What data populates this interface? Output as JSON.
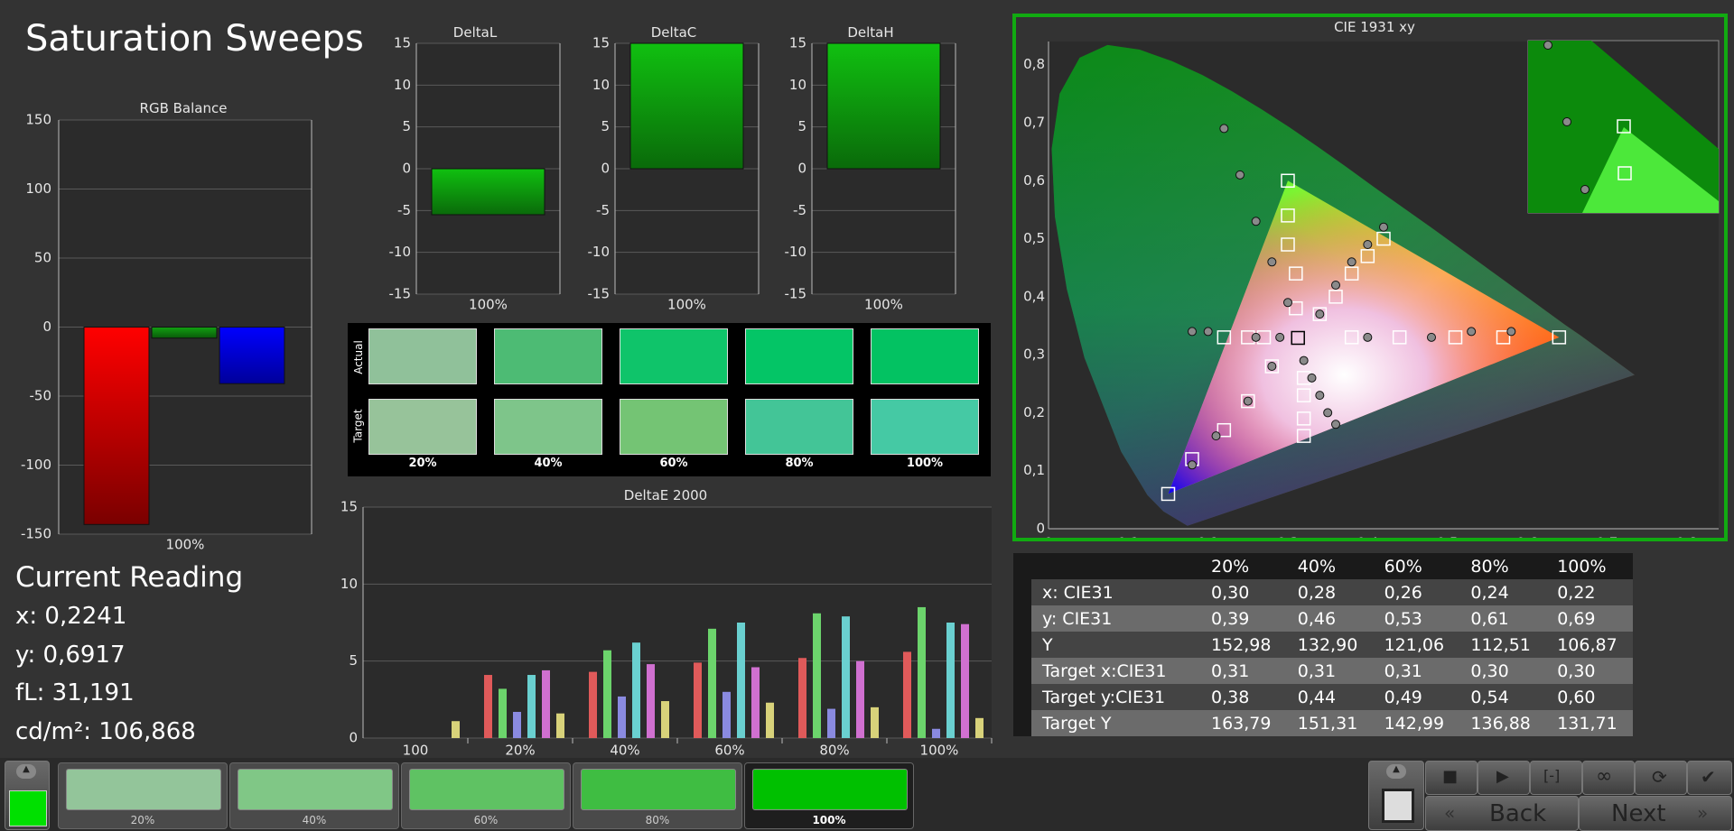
{
  "page": {
    "title": "Saturation Sweeps"
  },
  "colors": {
    "accent_green": "#00c800",
    "frame_green": "#11aa11",
    "selected_swatch": "#00c800"
  },
  "rgb_balance": {
    "title": "RGB Balance",
    "y_ticks": [
      "150",
      "100",
      "50",
      "0",
      "-50",
      "-100",
      "-150"
    ],
    "x_label": "100%",
    "chart_data": {
      "type": "bar",
      "categories": [
        "R",
        "G",
        "B"
      ],
      "values": [
        -143,
        -8,
        -41
      ],
      "ylim": [
        -150,
        150
      ]
    }
  },
  "delta_l": {
    "title": "DeltaL",
    "y_ticks": [
      "15",
      "10",
      "5",
      "0",
      "-5",
      "-10",
      "-15"
    ],
    "x_label": "100%",
    "chart_data": {
      "type": "bar",
      "values": [
        -5.5
      ],
      "ylim": [
        -15,
        15
      ]
    }
  },
  "delta_c": {
    "title": "DeltaC",
    "y_ticks": [
      "15",
      "10",
      "5",
      "0",
      "-5",
      "-10",
      "-15"
    ],
    "x_label": "100%",
    "chart_data": {
      "type": "bar",
      "values": [
        15
      ],
      "ylim": [
        -15,
        15
      ]
    }
  },
  "delta_h": {
    "title": "DeltaH",
    "y_ticks": [
      "15",
      "10",
      "5",
      "0",
      "-5",
      "-10",
      "-15"
    ],
    "x_label": "100%",
    "chart_data": {
      "type": "bar",
      "values": [
        15
      ],
      "ylim": [
        -15,
        15
      ]
    }
  },
  "comparison": {
    "row_actual": "Actual",
    "row_target": "Target",
    "labels": [
      "20%",
      "40%",
      "60%",
      "80%",
      "100%"
    ],
    "actual_colors": [
      "#90c19a",
      "#4dbb74",
      "#0fc46a",
      "#04c566",
      "#03c262"
    ],
    "target_colors": [
      "#97c39a",
      "#7ec58a",
      "#74c474",
      "#43c597",
      "#45c9a4"
    ]
  },
  "delta_e": {
    "title": "DeltaE 2000",
    "y_ticks": [
      "15",
      "10",
      "5",
      "0"
    ],
    "x_labels": [
      "100",
      "20%",
      "40%",
      "60%",
      "80%",
      "100%"
    ],
    "chart_data": {
      "type": "bar",
      "ylim": [
        0,
        15
      ],
      "categories": [
        "100",
        "20%",
        "40%",
        "60%",
        "80%",
        "100%"
      ],
      "series": [
        {
          "values": [
            0,
            4.1,
            4.3,
            4.9,
            5.2,
            5.6
          ]
        },
        {
          "values": [
            0,
            3.2,
            5.7,
            7.1,
            8.1,
            8.5
          ]
        },
        {
          "values": [
            0,
            1.7,
            2.7,
            3.0,
            1.9,
            0.6
          ]
        },
        {
          "values": [
            0,
            4.1,
            6.2,
            7.5,
            7.9,
            7.5
          ]
        },
        {
          "values": [
            0,
            4.4,
            4.8,
            4.6,
            5.0,
            7.4
          ]
        },
        {
          "values": [
            1.1,
            1.6,
            2.4,
            2.3,
            2.0,
            1.3
          ]
        }
      ],
      "series_colors": [
        "#e05a5a",
        "#6cd46c",
        "#8a8ae0",
        "#6ad0d0",
        "#d070d0",
        "#d8d27a"
      ]
    }
  },
  "cie": {
    "title": "CIE 1931 xy",
    "x_ticks": [
      "0",
      "0,1",
      "0,2",
      "0,3",
      "0,4",
      "0,5",
      "0,6",
      "0,7",
      "0,8"
    ],
    "y_ticks": [
      "0,8",
      "0,7",
      "0,6",
      "0,5",
      "0,4",
      "0,3",
      "0,2",
      "0,1",
      "0"
    ],
    "chart_data": {
      "type": "scatter",
      "xlim": [
        0,
        0.84
      ],
      "ylim": [
        0,
        0.84
      ],
      "gamut_triangle": [
        [
          0.64,
          0.33
        ],
        [
          0.3,
          0.6
        ],
        [
          0.15,
          0.06
        ]
      ],
      "white_point": [
        0.3127,
        0.329
      ],
      "targets": [
        [
          0.3,
          0.6
        ],
        [
          0.3,
          0.54
        ],
        [
          0.3,
          0.49
        ],
        [
          0.31,
          0.44
        ],
        [
          0.31,
          0.38
        ],
        [
          0.42,
          0.5
        ],
        [
          0.4,
          0.47
        ],
        [
          0.38,
          0.44
        ],
        [
          0.36,
          0.4
        ],
        [
          0.34,
          0.37
        ],
        [
          0.64,
          0.33
        ],
        [
          0.57,
          0.33
        ],
        [
          0.51,
          0.33
        ],
        [
          0.44,
          0.33
        ],
        [
          0.38,
          0.33
        ],
        [
          0.28,
          0.28
        ],
        [
          0.25,
          0.22
        ],
        [
          0.22,
          0.17
        ],
        [
          0.18,
          0.12
        ],
        [
          0.15,
          0.06
        ],
        [
          0.32,
          0.26
        ],
        [
          0.32,
          0.23
        ],
        [
          0.32,
          0.19
        ],
        [
          0.32,
          0.16
        ],
        [
          0.22,
          0.33
        ],
        [
          0.25,
          0.33
        ],
        [
          0.27,
          0.33
        ]
      ],
      "actuals": [
        [
          0.22,
          0.69
        ],
        [
          0.24,
          0.61
        ],
        [
          0.26,
          0.53
        ],
        [
          0.28,
          0.46
        ],
        [
          0.3,
          0.39
        ],
        [
          0.42,
          0.52
        ],
        [
          0.4,
          0.49
        ],
        [
          0.38,
          0.46
        ],
        [
          0.36,
          0.42
        ],
        [
          0.34,
          0.37
        ],
        [
          0.58,
          0.34
        ],
        [
          0.53,
          0.34
        ],
        [
          0.48,
          0.33
        ],
        [
          0.4,
          0.33
        ],
        [
          0.28,
          0.28
        ],
        [
          0.25,
          0.22
        ],
        [
          0.21,
          0.16
        ],
        [
          0.18,
          0.11
        ],
        [
          0.32,
          0.29
        ],
        [
          0.33,
          0.26
        ],
        [
          0.34,
          0.23
        ],
        [
          0.35,
          0.2
        ],
        [
          0.36,
          0.18
        ],
        [
          0.18,
          0.34
        ],
        [
          0.2,
          0.34
        ],
        [
          0.26,
          0.33
        ],
        [
          0.29,
          0.33
        ]
      ],
      "current": [
        0.3127,
        0.329
      ]
    }
  },
  "current_reading": {
    "title": "Current Reading",
    "x": "x: 0,2241",
    "y": "y: 0,6917",
    "fl": "fL: 31,191",
    "cdm2": "cd/m²: 106,868"
  },
  "table": {
    "headers": [
      "20%",
      "40%",
      "60%",
      "80%",
      "100%"
    ],
    "rows": [
      {
        "label": "x: CIE31",
        "values": [
          "0,30",
          "0,28",
          "0,26",
          "0,24",
          "0,22"
        ]
      },
      {
        "label": "y: CIE31",
        "values": [
          "0,39",
          "0,46",
          "0,53",
          "0,61",
          "0,69"
        ]
      },
      {
        "label": "Y",
        "values": [
          "152,98",
          "132,90",
          "121,06",
          "112,51",
          "106,87"
        ]
      },
      {
        "label": "Target x:CIE31",
        "values": [
          "0,31",
          "0,31",
          "0,31",
          "0,30",
          "0,30"
        ]
      },
      {
        "label": "Target y:CIE31",
        "values": [
          "0,38",
          "0,44",
          "0,49",
          "0,54",
          "0,60"
        ]
      },
      {
        "label": "Target Y",
        "values": [
          "163,79",
          "151,31",
          "142,99",
          "136,88",
          "131,71"
        ]
      }
    ]
  },
  "bottom": {
    "swatches": [
      {
        "label": "20%",
        "color": "#93c59a"
      },
      {
        "label": "40%",
        "color": "#80c786"
      },
      {
        "label": "60%",
        "color": "#5fc263"
      },
      {
        "label": "80%",
        "color": "#3fbd42"
      },
      {
        "label": "100%",
        "color": "#00c000"
      }
    ],
    "back_label": "Back",
    "next_label": "Next"
  }
}
